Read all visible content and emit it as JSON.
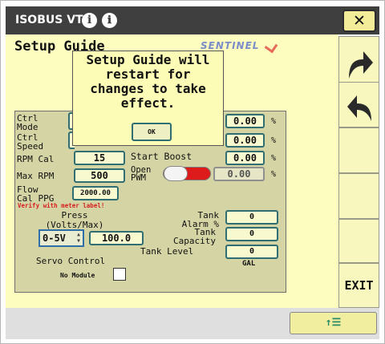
{
  "header": {
    "app_title": "ISOBUS VT",
    "info_icon_glyph": "i",
    "help_icon_glyph": "ℹ",
    "close_glyph": "✕"
  },
  "page": {
    "title": "Setup Guide",
    "brand_logo": "SENTINEL"
  },
  "form": {
    "ctrl_mode_label": "Ctrl\nMode",
    "ctrl_speed_label": "Ctrl\nSpeed",
    "rpm_cal_label": "RPM Cal",
    "rpm_cal_value": "15",
    "max_rpm_label": "Max RPM",
    "max_rpm_value": "500",
    "flow_cal_label": "Flow\nCal PPG",
    "flow_cal_value": "2000.00",
    "verify_warning": "Verify with meter label!",
    "press_label": "Press\n(Volts/Max)",
    "press_range_value": "0-5V",
    "press_max_value": "100.0",
    "servo_control_label": "Servo Control",
    "no_module_label": "No Module",
    "no_module_checked": false,
    "field1_value": "0.00",
    "field2_value": "0.00",
    "start_boost_label": "Start Boost",
    "start_boost_value": "0.00",
    "open_pwm_label": "Open\nPWM",
    "open_pwm_value": "0.00",
    "open_pwm_toggle": "off",
    "percent_unit": "%",
    "tank_alarm_label": "Tank\nAlarm %",
    "tank_alarm_value": "0",
    "tank_capacity_label": "Tank\nCapacity",
    "tank_capacity_value": "0",
    "tank_level_label": "Tank Level",
    "tank_level_value": "0",
    "tank_level_unit": "GAL"
  },
  "dialog": {
    "message": "Setup Guide will\nrestart for\nchanges to take\neffect.",
    "ok_label": "OK"
  },
  "softkeys": {
    "next_icon": "arrow-right-icon",
    "back_icon": "arrow-left-icon",
    "exit_label": "EXIT"
  },
  "footer": {
    "button_glyph": "↑☰"
  },
  "colors": {
    "title_bar": "#3f3f3f",
    "screen_bg": "#fdfdc0",
    "panel_bg": "#d5d4a4",
    "field_border": "#2f6e73",
    "warning": "#d62020",
    "toggle_red": "#dd1b1b"
  }
}
